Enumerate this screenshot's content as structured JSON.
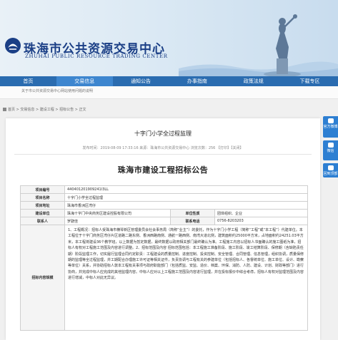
{
  "header": {
    "site_title": "珠海市公共资源交易中心",
    "site_title_en": "ZHUHAI PUBLIC RESOURCE TRADING CENTER"
  },
  "nav": {
    "items": [
      {
        "label": "首页"
      },
      {
        "label": "交易信息"
      },
      {
        "label": "通知公告"
      },
      {
        "label": "办事指南"
      },
      {
        "label": "政策法规"
      },
      {
        "label": "下载专区"
      }
    ]
  },
  "ticker": {
    "text": "关于市公共资源交易中心网站使用问题的说明"
  },
  "breadcrumb": {
    "text": "首页 > 交易信息 > 建设工程 > 招标公告 > 正文"
  },
  "article": {
    "page_title": "十字门小学全过程监理",
    "meta": "发布时间：2019-08-09 17:33:16    来源：珠海市公共资源交易中心    浏览次数：256    【打印】【关闭】",
    "doc_title": "珠海市建设工程招标公告"
  },
  "table": {
    "project_code_label": "项目编号",
    "project_code": "440401201909241I3LL",
    "project_name_label": "项目名称",
    "project_name": "十字门小学全过程监理",
    "project_addr_label": "项目地址",
    "project_addr": "珠海市香洲区湾仔",
    "owner_label": "建设单位",
    "owner": "珠海十字门中央商务区建设控股有限公司",
    "unit_type_label": "单位性质",
    "unit_type": "团体组织、企业",
    "contact_label": "联系人",
    "contact": "罗骁佳",
    "phone_label": "联系电话",
    "phone": "0756-8203203",
    "content_label": "招标内容规模",
    "content": "1、工程概况：招标人受珠海市横琴新区管理委员会社会事务局（简称“业主”）的委托，作为十字门小学工程（简称“工程”或“本工程”）代建单位。本工程位于十字门商务区湾仔片区道路二路东侧、香洲西路南侧、通航一路西侧、南湾大道北侧，建筑面积约25000平方米，占地面积约24251.03平方米，本工程将建设36个教学班，以上数据为暂定数据，最终数据以政府相关部门最终确认为准。工程施工内容以招标人书面确认的施工图纸为准，招标人有权对工程施工范围及内容进行调整。2、招标范围及内容 招标范围包括：本工程施工准备阶段、施工阶段、竣工结算阶段、保修期（含缺陷责任期）阶段监理工作，切实履行监理合同约定职责：工程建设的质量控制、进度控制、投资控制、安全管理、合同管理、信息管理，组织协调，质量保修期的监理等全过程监理，并工期配合办理施工许可证等相关证件，负责协调与工程有关的参建单位（包括招标人、各督统单位、施工单位、设计、勘察等单位）关系，并协助招标人敦本工程有关事项与政府职能部门（包括质监、安监、造价、档案、环保、消防、人防、建设、计划、财政等部门）进行协商，并完成中标人应完成的其他监理内容。中标人应对以上工程施工范围及内容进行监理，并在投标报价中综合考虑，招标人有权对监理范围及内容进行增减，中标人对此无异议。"
  },
  "sidebar": {
    "weibo_label": "官方微博",
    "wechat_label": "微信",
    "top_label": "回到顶部"
  },
  "colors": {
    "nav_bg": "#2a6cb0",
    "title_blue": "#1b3f86",
    "side_blue": "#2d7fd2"
  }
}
